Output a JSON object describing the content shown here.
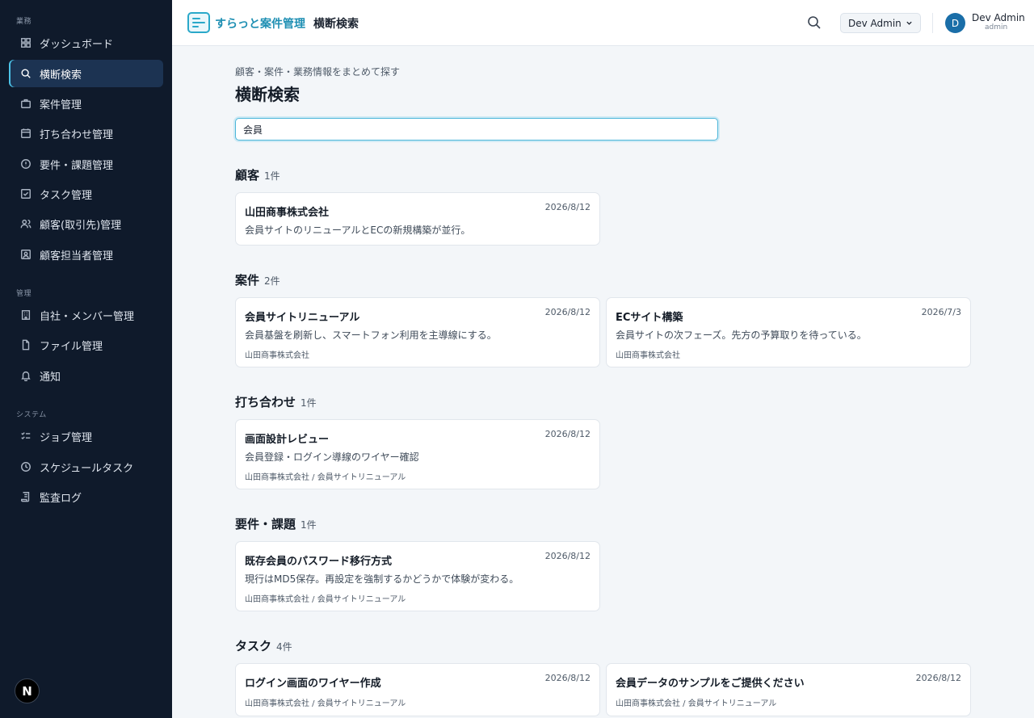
{
  "sidebar": {
    "section_gyomu": "業務",
    "section_kanri": "管理",
    "section_system": "システム",
    "items": [
      {
        "label": "ダッシュボード",
        "icon": "dashboard-icon"
      },
      {
        "label": "横断検索",
        "icon": "search-icon",
        "active": true
      },
      {
        "label": "案件管理",
        "icon": "briefcase-icon"
      },
      {
        "label": "打ち合わせ管理",
        "icon": "calendar-icon"
      },
      {
        "label": "要件・課題管理",
        "icon": "alert-circle-icon"
      },
      {
        "label": "タスク管理",
        "icon": "checkbox-icon"
      },
      {
        "label": "顧客(取引先)管理",
        "icon": "users-icon"
      },
      {
        "label": "顧客担当者管理",
        "icon": "contact-icon"
      },
      {
        "label": "自社・メンバー管理",
        "icon": "building-icon"
      },
      {
        "label": "ファイル管理",
        "icon": "file-icon"
      },
      {
        "label": "通知",
        "icon": "bell-icon"
      },
      {
        "label": "ジョブ管理",
        "icon": "list-check-icon"
      },
      {
        "label": "スケジュールタスク",
        "icon": "clock-icon"
      },
      {
        "label": "監査ログ",
        "icon": "scroll-icon"
      }
    ],
    "badge": "N"
  },
  "header": {
    "brand": "すらっと案件管理",
    "page_title": "横断検索",
    "user_select": "Dev Admin",
    "avatar_initial": "D",
    "user_name": "Dev Admin",
    "user_role": "admin"
  },
  "main": {
    "breadcrumb": "顧客・案件・業務情報をまとめて探す",
    "title": "横断検索",
    "search_value": "会員",
    "sections": [
      {
        "title": "顧客",
        "count": "1件",
        "cards": [
          {
            "title": "山田商事株式会社",
            "date": "2026/8/12",
            "desc": "会員サイトのリニューアルとECの新規構築が並行。",
            "sub": ""
          }
        ]
      },
      {
        "title": "案件",
        "count": "2件",
        "cards": [
          {
            "title": "会員サイトリニューアル",
            "date": "2026/8/12",
            "desc": "会員基盤を刷新し、スマートフォン利用を主導線にする。",
            "sub": "山田商事株式会社"
          },
          {
            "title": "ECサイト構築",
            "date": "2026/7/3",
            "desc": "会員サイトの次フェーズ。先方の予算取りを待っている。",
            "sub": "山田商事株式会社"
          }
        ]
      },
      {
        "title": "打ち合わせ",
        "count": "1件",
        "cards": [
          {
            "title": "画面設計レビュー",
            "date": "2026/8/12",
            "desc": "会員登録・ログイン導線のワイヤー確認",
            "sub": "山田商事株式会社 / 会員サイトリニューアル"
          }
        ]
      },
      {
        "title": "要件・課題",
        "count": "1件",
        "cards": [
          {
            "title": "既存会員のパスワード移行方式",
            "date": "2026/8/12",
            "desc": "現行はMD5保存。再設定を強制するかどうかで体験が変わる。",
            "sub": "山田商事株式会社 / 会員サイトリニューアル"
          }
        ]
      },
      {
        "title": "タスク",
        "count": "4件",
        "cards": [
          {
            "title": "ログイン画面のワイヤー作成",
            "date": "2026/8/12",
            "desc": "",
            "sub": "山田商事株式会社 / 会員サイトリニューアル"
          },
          {
            "title": "会員データのサンプルをご提供ください",
            "date": "2026/8/12",
            "desc": "",
            "sub": "山田商事株式会社 / 会員サイトリニューアル"
          }
        ]
      }
    ]
  }
}
